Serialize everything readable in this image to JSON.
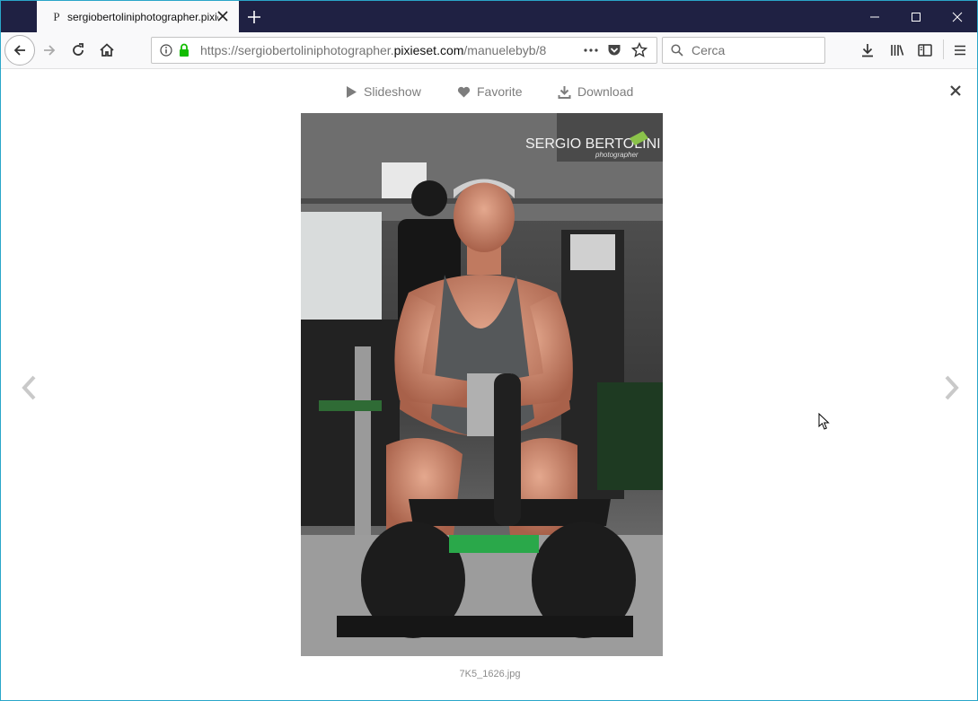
{
  "browser": {
    "tab": {
      "favicon": "P",
      "title": "sergiobertolinipho­tographer.pixieset.com"
    },
    "address": {
      "prefix": "https://sergiobertolinipho­tographer.",
      "domain": "pixieset.com",
      "path": "/manuelebyb/8..."
    },
    "search": {
      "placeholder": "Cerca"
    },
    "icons": [
      "back-icon",
      "forward-icon",
      "reload-icon",
      "home-icon",
      "info-icon",
      "lock-icon",
      "page-actions-icon",
      "pocket-icon",
      "bookmark-star-icon",
      "search-icon",
      "downloads-icon",
      "library-icon",
      "sidebar-icon",
      "menu-icon",
      "minimize-icon",
      "maximize-icon",
      "close-window-icon",
      "new-tab-icon"
    ]
  },
  "lightbox": {
    "actions": [
      {
        "label": "Slideshow",
        "icon": "play-icon"
      },
      {
        "label": "Favorite",
        "icon": "heart-icon"
      },
      {
        "label": "Download",
        "icon": "download-icon"
      }
    ],
    "photo": {
      "watermark_line1": "SERGIO BERTOLINI",
      "watermark_line2": "photographer"
    },
    "filename": "7K5_1626.jpg"
  }
}
